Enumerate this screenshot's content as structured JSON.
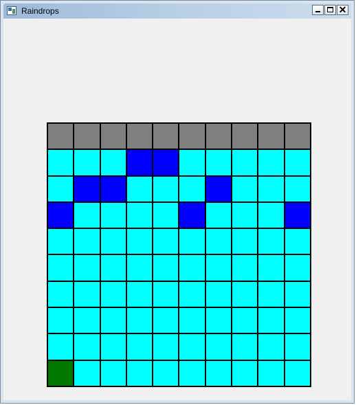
{
  "window": {
    "title": "Raindrops",
    "icon": "app-window-icon",
    "close_glyph": "✕"
  },
  "colors": {
    "cloud": "#808080",
    "water": "#00ffff",
    "drop": "#0000ff",
    "player": "#007800"
  },
  "board": {
    "rows": 10,
    "cols": 10,
    "grid": [
      [
        "cloud",
        "cloud",
        "cloud",
        "cloud",
        "cloud",
        "cloud",
        "cloud",
        "cloud",
        "cloud",
        "cloud"
      ],
      [
        "water",
        "water",
        "water",
        "drop",
        "drop",
        "water",
        "water",
        "water",
        "water",
        "water"
      ],
      [
        "water",
        "drop",
        "drop",
        "water",
        "water",
        "water",
        "drop",
        "water",
        "water",
        "water"
      ],
      [
        "drop",
        "water",
        "water",
        "water",
        "water",
        "drop",
        "water",
        "water",
        "water",
        "drop"
      ],
      [
        "water",
        "water",
        "water",
        "water",
        "water",
        "water",
        "water",
        "water",
        "water",
        "water"
      ],
      [
        "water",
        "water",
        "water",
        "water",
        "water",
        "water",
        "water",
        "water",
        "water",
        "water"
      ],
      [
        "water",
        "water",
        "water",
        "water",
        "water",
        "water",
        "water",
        "water",
        "water",
        "water"
      ],
      [
        "water",
        "water",
        "water",
        "water",
        "water",
        "water",
        "water",
        "water",
        "water",
        "water"
      ],
      [
        "water",
        "water",
        "water",
        "water",
        "water",
        "water",
        "water",
        "water",
        "water",
        "water"
      ],
      [
        "player",
        "water",
        "water",
        "water",
        "water",
        "water",
        "water",
        "water",
        "water",
        "water"
      ]
    ]
  }
}
